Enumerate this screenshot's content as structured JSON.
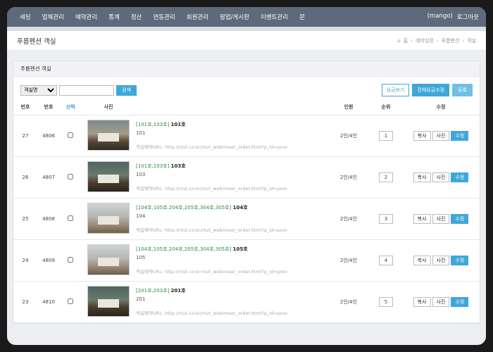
{
  "nav": {
    "items": [
      "세팅",
      "업체관리",
      "예약관리",
      "통계",
      "정산",
      "연동관리",
      "회원관리",
      "팝업/게시판",
      "이벤트관리",
      "문"
    ],
    "user": "(mango)",
    "logout": "로그아웃"
  },
  "page": {
    "title": "푸름펜션 객실",
    "breadcrumb": [
      "홈",
      "예약설정",
      "푸름펜션",
      "객실"
    ]
  },
  "panel": {
    "title": "푸름펜션 객실"
  },
  "controls": {
    "select_value": "객실명",
    "search_placeholder": "",
    "search_label": "검색",
    "price_view_label": "요금보기",
    "bulk_price_label": "전체요금수정",
    "register_label": "등록"
  },
  "table": {
    "headers": [
      "번호",
      "번호",
      "선택",
      "사진",
      "",
      "인원",
      "순위",
      "수정"
    ],
    "rows": [
      {
        "num": "27",
        "code": "4806",
        "tag": "[101호,103호]",
        "name": "101호",
        "sub": "101",
        "url": "객실예약URL: http://rsvt.co.kr/rsvt_web/reser_order.html?p_id=pooreum",
        "people": "2인/4인",
        "rank": "1",
        "copy": "복사",
        "photo": "사진",
        "edit": "수정"
      },
      {
        "num": "26",
        "code": "4807",
        "tag": "[101호,103호]",
        "name": "103호",
        "sub": "103",
        "url": "객실예약URL: http://rsvt.co.kr/rsvt_web/reser_order.html?p_id=pooreum",
        "people": "2인/4인",
        "rank": "2",
        "copy": "복사",
        "photo": "사진",
        "edit": "수정"
      },
      {
        "num": "25",
        "code": "4808",
        "tag": "[104호,105호,204호,205호,304호,305호]",
        "name": "104호",
        "sub": "104",
        "url": "객실예약URL: http://rsvt.co.kr/rsvt_web/reser_order.html?p_id=pooreum",
        "people": "2인/4인",
        "rank": "3",
        "copy": "복사",
        "photo": "사진",
        "edit": "수정"
      },
      {
        "num": "24",
        "code": "4809",
        "tag": "[104호,105호,204호,205호,304호,305호]",
        "name": "105호",
        "sub": "105",
        "url": "객실예약URL: http://rsvt.co.kr/rsvt_web/reser_order.html?p_id=pooreum",
        "people": "2인/4인",
        "rank": "4",
        "copy": "복사",
        "photo": "사진",
        "edit": "수정"
      },
      {
        "num": "23",
        "code": "4810",
        "tag": "[201호,203호]",
        "name": "201호",
        "sub": "201",
        "url": "객실예약URL: http://rsvt.co.kr/rsvt_web/reser_order.html?p_id=pooreum",
        "people": "2인/4인",
        "rank": "5",
        "copy": "복사",
        "photo": "사진",
        "edit": "수정"
      }
    ]
  }
}
